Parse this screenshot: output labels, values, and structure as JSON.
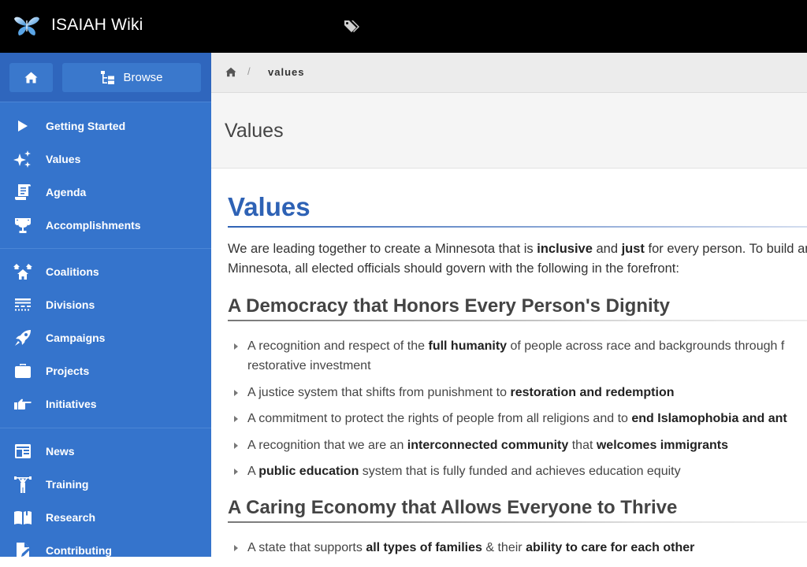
{
  "app": {
    "title": "ISAIAH Wiki"
  },
  "header": {
    "tag_icon": "tags-icon"
  },
  "sidebar": {
    "home_icon": "home-icon",
    "browse_label": "Browse",
    "browse_icon": "sitemap-icon",
    "groups": [
      [
        {
          "label": "Getting Started",
          "icon": "play-icon"
        },
        {
          "label": "Values",
          "icon": "sparkles-icon"
        },
        {
          "label": "Agenda",
          "icon": "scroll-icon"
        },
        {
          "label": "Accomplishments",
          "icon": "trophy-icon"
        }
      ],
      [
        {
          "label": "Coalitions",
          "icon": "houses-icon"
        },
        {
          "label": "Divisions",
          "icon": "divisions-icon"
        },
        {
          "label": "Campaigns",
          "icon": "rocket-icon"
        },
        {
          "label": "Projects",
          "icon": "briefcase-icon"
        },
        {
          "label": "Initiatives",
          "icon": "hand-pointing-icon"
        }
      ],
      [
        {
          "label": "News",
          "icon": "newspaper-icon"
        },
        {
          "label": "Training",
          "icon": "weightlifter-icon"
        },
        {
          "label": "Research",
          "icon": "book-open-icon"
        },
        {
          "label": "Contributing",
          "icon": "file-edit-icon"
        }
      ]
    ]
  },
  "breadcrumb": {
    "separator": "/",
    "current": "values"
  },
  "page": {
    "header_title": "Values",
    "heading": "Values",
    "intro": {
      "parts": [
        {
          "text": "We are leading together to create a Minnesota that is ",
          "bold": false
        },
        {
          "text": "inclusive",
          "bold": true
        },
        {
          "text": " and ",
          "bold": false
        },
        {
          "text": "just",
          "bold": true
        },
        {
          "text": " for every person. To build an",
          "bold": false
        }
      ],
      "line2": "Minnesota, all elected officials should govern with the following in the forefront:"
    },
    "sections": [
      {
        "title": "A Democracy that Honors Every Person's Dignity",
        "items": [
          [
            {
              "text": "A recognition and respect of the ",
              "bold": false
            },
            {
              "text": "full humanity",
              "bold": true
            },
            {
              "text": " of people across race and backgrounds through f",
              "bold": false
            }
          ],
          [
            {
              "text": "A justice system that shifts from punishment to ",
              "bold": false
            },
            {
              "text": "restoration and redemption",
              "bold": true
            }
          ],
          [
            {
              "text": "A commitment to protect the rights of people from all religions and to ",
              "bold": false
            },
            {
              "text": "end Islamophobia and ant",
              "bold": true
            }
          ],
          [
            {
              "text": "A recognition that we are an ",
              "bold": false
            },
            {
              "text": "interconnected community",
              "bold": true
            },
            {
              "text": " that ",
              "bold": false
            },
            {
              "text": "welcomes immigrants",
              "bold": true
            }
          ],
          [
            {
              "text": "A ",
              "bold": false
            },
            {
              "text": "public education",
              "bold": true
            },
            {
              "text": " system that is fully funded and achieves education equity",
              "bold": false
            }
          ]
        ],
        "first_item_line2": "restorative investment"
      },
      {
        "title": "A Caring Economy that Allows Everyone to Thrive",
        "items": [
          [
            {
              "text": "A state that supports ",
              "bold": false
            },
            {
              "text": "all types of families",
              "bold": true
            },
            {
              "text": " & their ",
              "bold": false
            },
            {
              "text": "ability to care for each other",
              "bold": true
            }
          ]
        ]
      }
    ]
  },
  "colors": {
    "topbar": "#000000",
    "sidebar": "#3574cc",
    "accent": "#2e62b5",
    "breadcrumb_bg": "#ececec",
    "page_header_bg": "#f5f5f5"
  }
}
